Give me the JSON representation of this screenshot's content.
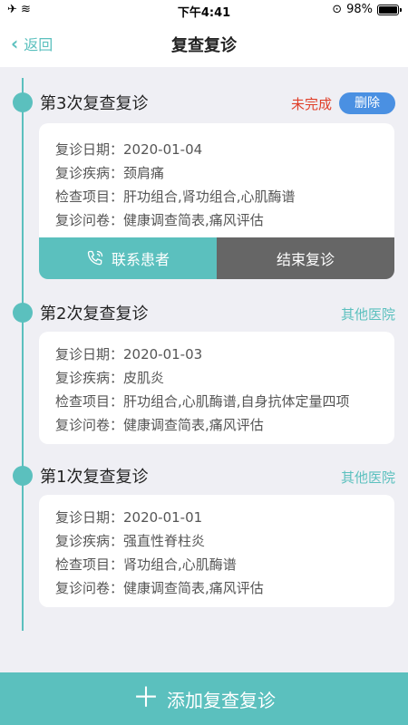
{
  "status_bar": {
    "time": "下午4:41",
    "battery": "98%"
  },
  "nav": {
    "back_label": "返回",
    "title": "复查复诊"
  },
  "entries": [
    {
      "title": "第3次复查复诊",
      "status": "未完成",
      "delete_label": "删除",
      "rows": [
        "复诊日期：2020-01-04",
        "复诊疾病：颈肩痛",
        "检查项目：肝功组合,肾功组合,心肌酶谱",
        "复诊问卷：健康调查简表,痛风评估"
      ],
      "contact_label": "联系患者",
      "finish_label": "结束复诊"
    },
    {
      "title": "第2次复查复诊",
      "status": "其他医院",
      "rows": [
        "复诊日期：2020-01-03",
        "复诊疾病：皮肌炎",
        "检查项目：肝功组合,心肌酶谱,自身抗体定量四项",
        "复诊问卷：健康调查简表,痛风评估"
      ]
    },
    {
      "title": "第1次复查复诊",
      "status": "其他医院",
      "rows": [
        "复诊日期：2020-01-01",
        "复诊疾病：强直性脊柱炎",
        "检查项目：肾功组合,心肌酶谱",
        "复诊问卷：健康调查简表,痛风评估"
      ]
    }
  ],
  "add_button_label": "添加复查复诊",
  "colors": {
    "accent": "#5bc0be",
    "danger": "#e0402a",
    "delete": "#4a90e2",
    "finish": "#666666"
  }
}
